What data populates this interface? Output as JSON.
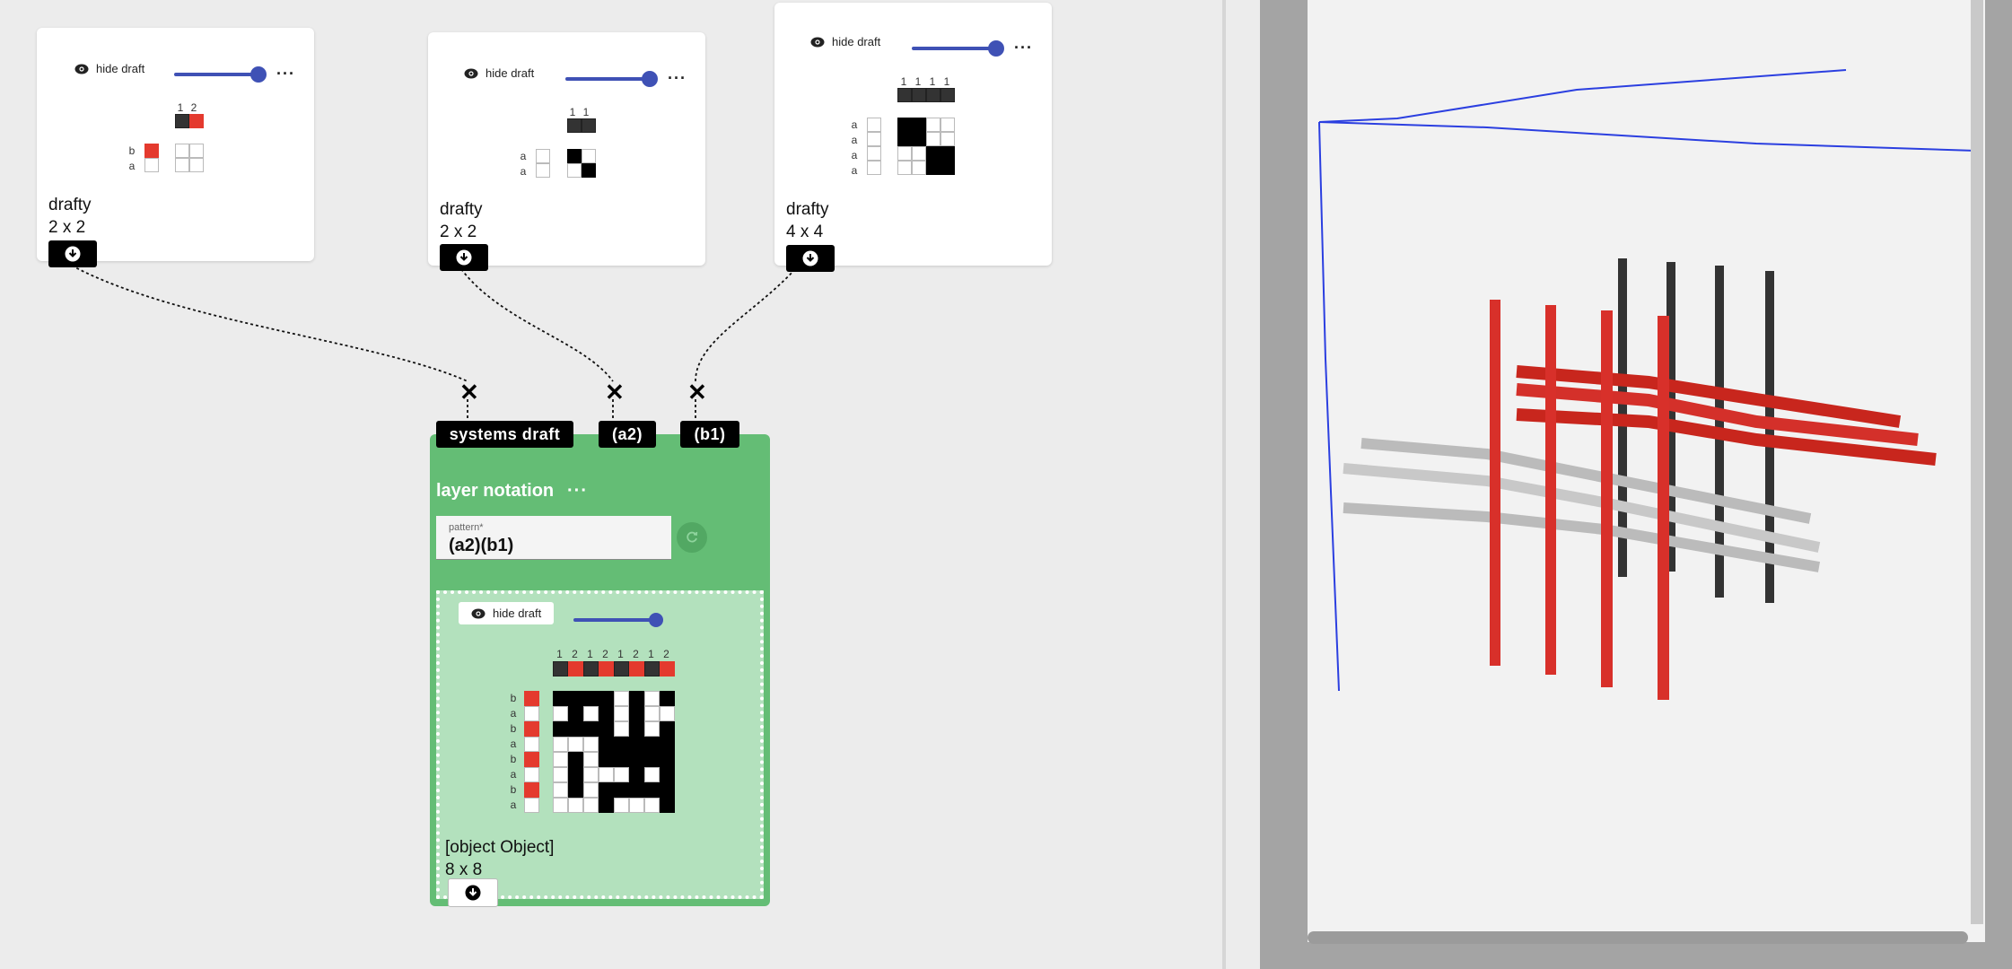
{
  "drafts": [
    {
      "hide_label": "hide draft",
      "name": "drafty",
      "size": "2 x 2",
      "col_labels": [
        "1",
        "2"
      ],
      "row_labels": [
        "b",
        "a"
      ]
    },
    {
      "hide_label": "hide draft",
      "name": "drafty",
      "size": "2 x 2",
      "col_labels": [
        "1",
        "1"
      ],
      "row_labels": [
        "a",
        "a"
      ]
    },
    {
      "hide_label": "hide draft",
      "name": "drafty",
      "size": "4 x 4",
      "col_labels": [
        "1",
        "1",
        "1",
        "1"
      ],
      "row_labels": [
        "a",
        "a",
        "a",
        "a"
      ]
    }
  ],
  "more_label": "···",
  "inputs": [
    {
      "label": "systems draft"
    },
    {
      "label": "(a2)"
    },
    {
      "label": "(b1)"
    }
  ],
  "operation": {
    "title": "layer notation",
    "pattern_label": "pattern*",
    "pattern_value": "(a2)(b1)",
    "output": {
      "hide_label": "hide draft",
      "name": "[object Object]",
      "size": "8 x 8",
      "col_labels": [
        "1",
        "2",
        "1",
        "2",
        "1",
        "2",
        "1",
        "2"
      ],
      "row_labels": [
        "b",
        "a",
        "b",
        "a",
        "b",
        "a",
        "b",
        "a"
      ]
    }
  },
  "colors": {
    "accent": "#3f51b5",
    "node_green": "#64bd75",
    "warp_red": "#e43a2e"
  }
}
